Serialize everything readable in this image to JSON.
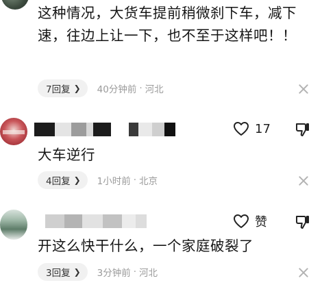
{
  "comments": [
    {
      "text": "这种情况，大货车提前稍微刹下车，减下速，往边上让一下，也不至于这样吧！！",
      "reply_label": "7回复",
      "time": "40分钟前",
      "location": "河北"
    },
    {
      "likes": "17",
      "text": "大车逆行",
      "reply_label": "4回复",
      "time": "1小时前",
      "location": "北京"
    },
    {
      "likes": "赞",
      "text": "开这么快干什么，一个家庭破裂了",
      "reply_label": "3回复",
      "time": "3分钟前",
      "location": "河北"
    }
  ],
  "icons": {
    "reply_chevron": "chevron-right-icon",
    "close": "close-icon",
    "like": "heart-icon",
    "dislike": "thumbs-down-icon"
  }
}
